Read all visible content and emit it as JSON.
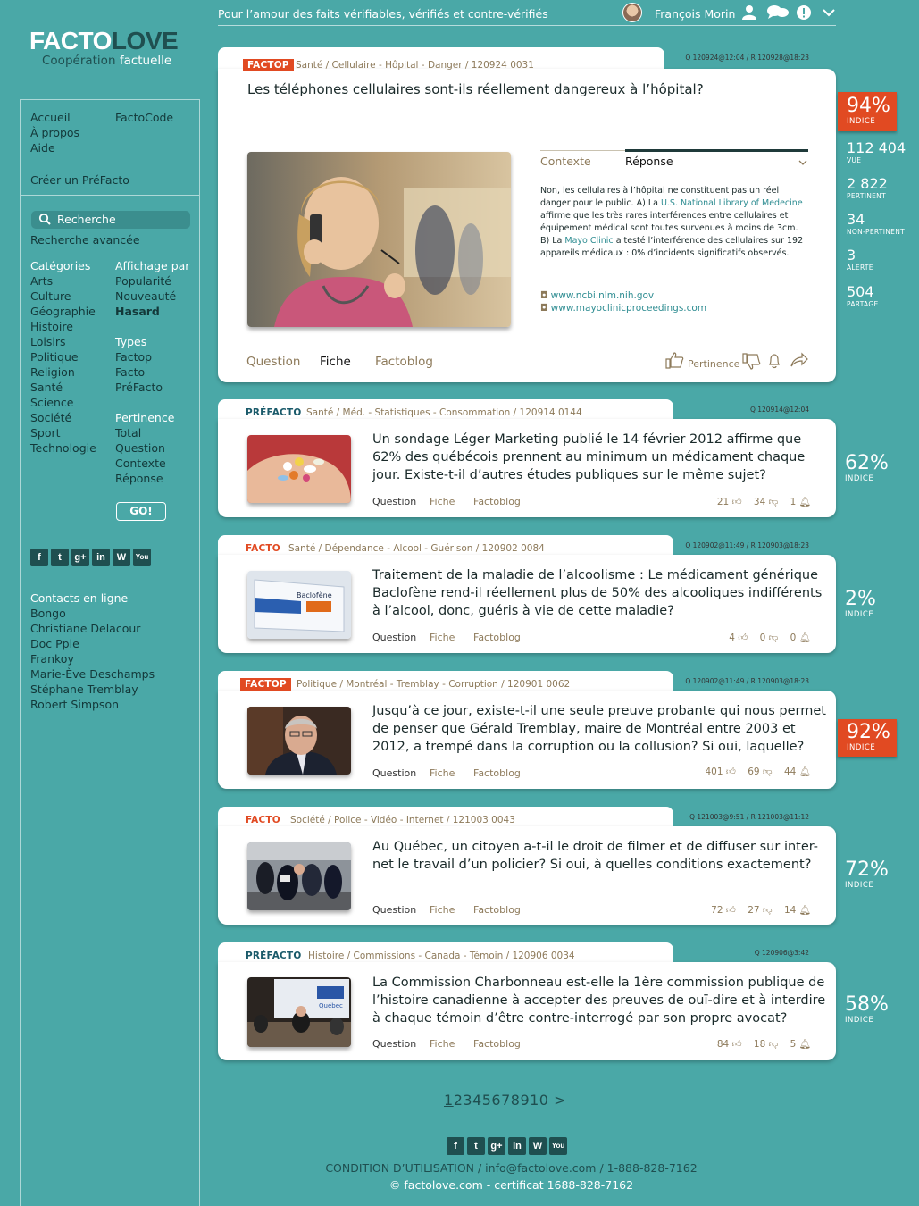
{
  "header": {
    "tagline": "Pour l’amour des faits vérifiables, vérifiés et contre-vérifiés",
    "user_name": "François Morin"
  },
  "logo": {
    "word_a": "FACTO",
    "word_b": "LOVE",
    "sub_a": "Coopération",
    "sub_b": "factuelle"
  },
  "sidebar": {
    "nav_left": [
      "Accueil",
      "À propos",
      "Aide"
    ],
    "nav_right": [
      "FactoCode"
    ],
    "create": "Créer un PréFacto",
    "search_placeholder": "Recherche",
    "advanced_search": "Recherche avancée",
    "categories_title": "Catégories",
    "categories": [
      "Arts",
      "Culture",
      "Géographie",
      "Histoire",
      "Loisirs",
      "Politique",
      "Religion",
      "Santé",
      "Science",
      "Société",
      "Sport",
      "Technologie"
    ],
    "display_title": "Affichage par",
    "display": [
      "Popularité",
      "Nouveauté",
      "Hasard"
    ],
    "types_title": "Types",
    "types": [
      "Factop",
      "Facto",
      "PréFacto"
    ],
    "pertinence_title": "Pertinence",
    "pertinence": [
      "Total",
      "Question",
      "Contexte",
      "Réponse"
    ],
    "go_button": "GO!",
    "social": [
      "f",
      "t",
      "g+",
      "in",
      "W",
      "You"
    ],
    "contacts_title": "Contacts en ligne",
    "contacts": [
      "Bongo",
      "Christiane Delacour",
      "Doc Pple",
      "Frankoy",
      "Marie-Ève Deschamps",
      "Stéphane Tremblay",
      "Robert Simpson"
    ]
  },
  "featured": {
    "badge": "FACTOP",
    "crumb": "Santé / Cellulaire - Hôpital - Danger / 120924 0031",
    "stamp": "Q 120924@12:04 / R 120928@18:23",
    "question": "Les téléphones cellulaires sont-ils réellement dangereux à l’hôpital?",
    "panel_tabs": [
      "Contexte",
      "Réponse"
    ],
    "answer_1": "Non, les cellulaires à l’hôpital ne constituent pas un réel danger pour le public. A) La ",
    "answer_link_1": "U.S. National Library of Medecine",
    "answer_2": " affirme que les très rares interférences entre cellulaires et équipement médical sont toutes survenues à moins de 3cm. B) La ",
    "answer_link_2": "Mayo Clinic",
    "answer_3": " a testé l’interférence des cellulaires sur 192 appareils médicaux : 0% d’incidents significatifs observés.",
    "sources": [
      "www.ncbi.nlm.nih.gov",
      "www.mayoclinicproceedings.com"
    ],
    "bottom_tabs": [
      "Question",
      "Fiche",
      "Factoblog"
    ],
    "pertinence_label": "Pertinence",
    "score": "94%",
    "score_label": "INDICE",
    "stats": [
      {
        "n": "112 404",
        "l": "VUE"
      },
      {
        "n": "2 822",
        "l": "PERTINENT"
      },
      {
        "n": "34",
        "l": "NON-PERTINENT"
      },
      {
        "n": "3",
        "l": "ALERTE"
      },
      {
        "n": "504",
        "l": "PARTAGE"
      }
    ]
  },
  "items": [
    {
      "badge": "PRÉFACTO",
      "crumb": "Santé / Méd. - Statistiques - Consommation / 120914 0144",
      "stamp": "Q 120914@12:04",
      "question": "Un sondage Léger Marketing publié le 14 février 2012 affirme que 62% des québécois prennent au minimum un médicament chaque jour. Existe-t-il d’autres études publiques sur le même sujet?",
      "tabs": [
        "Question",
        "Fiche",
        "Factoblog"
      ],
      "likes": "21",
      "dislikes": "34",
      "alerts": "1",
      "score": "62%",
      "score_label": "INDICE"
    },
    {
      "badge": "FACTO",
      "crumb": "Santé / Dépendance - Alcool - Guérison / 120902 0084",
      "stamp": "Q 120902@11:49 / R 120903@18:23",
      "question": "Traitement de la maladie de l’alcoolisme : Le médicament générique Baclofène rend-il réellement plus de 50% des alcooliques indifférents à l’alcool, donc, guéris à vie de cette maladie?",
      "tabs": [
        "Question",
        "Fiche",
        "Factoblog"
      ],
      "likes": "4",
      "dislikes": "0",
      "alerts": "0",
      "score": "2%",
      "score_label": "INDICE",
      "box_text": "Baclofène"
    },
    {
      "badge": "FACTOP",
      "crumb": "Politique / Montréal - Tremblay - Corruption / 120901 0062",
      "stamp": "Q 120902@11:49 / R 120903@18:23",
      "question": "Jusqu’à ce jour, existe-t-il une seule preuve probante qui nous permet de penser que Gérald Tremblay, maire de Montréal entre 2003 et 2012, a trempé dans la corruption ou la collusion? Si oui, laquelle?",
      "tabs": [
        "Question",
        "Fiche",
        "Factoblog"
      ],
      "likes": "401",
      "dislikes": "69",
      "alerts": "44",
      "score": "92%",
      "score_label": "INDICE"
    },
    {
      "badge": "FACTO",
      "crumb": "Société / Police - Vidéo - Internet / 121003 0043",
      "stamp": "Q 121003@9:51 / R 121003@11:12",
      "question": "Au Québec, un citoyen a-t-il le droit de filmer et de diffuser sur inter-net le travail d’un policier? Si oui, à quelles conditions exactement?",
      "tabs": [
        "Question",
        "Fiche",
        "Factoblog"
      ],
      "likes": "72",
      "dislikes": "27",
      "alerts": "14",
      "score": "72%",
      "score_label": "INDICE"
    },
    {
      "badge": "PRÉFACTO",
      "crumb": "Histoire / Commissions - Canada - Témoin / 120906 0034",
      "stamp": "Q 120906@3:42",
      "question": "La Commission Charbonneau est-elle la 1ère commission publique de l’histoire canadienne à accepter des preuves de ouï-dire et à interdire à chaque témoin d’être contre-interrogé par son propre avocat?",
      "tabs": [
        "Question",
        "Fiche",
        "Factoblog"
      ],
      "likes": "84",
      "dislikes": "18",
      "alerts": "5",
      "score": "58%",
      "score_label": "INDICE",
      "screen_text": "Québec"
    }
  ],
  "pager": {
    "current": "1",
    "pages": "2345678910",
    "next": ">"
  },
  "footer": {
    "social": [
      "f",
      "t",
      "g+",
      "in",
      "W",
      "You"
    ],
    "line1": "CONDITION D’UTILISATION / info@factolove.com / 1-888-828-7162",
    "line2": "© factolove.com - certificat 1688-828-7162"
  },
  "colors": {
    "teal": "#4aa8a7",
    "accent": "#e14a22",
    "dark_teal": "#1f4f50",
    "crumb": "#8d7a5a"
  }
}
